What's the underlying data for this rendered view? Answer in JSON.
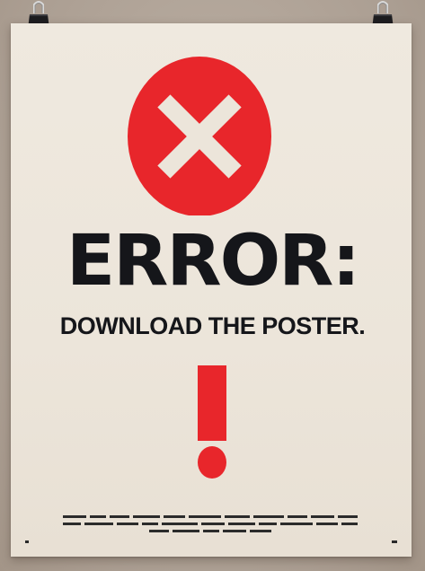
{
  "poster": {
    "headline": "ERROR:",
    "subline": "DOWNLOAD THE POSTER.",
    "fine_print_line1": "",
    "fine_print_line2": "",
    "fine_print_line3": ""
  },
  "icons": {
    "badge": "x-circle-icon",
    "exclamation": "exclamation-icon",
    "clip": "binder-clip-icon"
  },
  "colors": {
    "accent_red": "#e8262b",
    "text_dark": "#15161a",
    "poster_paper": "#ece5da",
    "wall": "#b3a69a"
  }
}
